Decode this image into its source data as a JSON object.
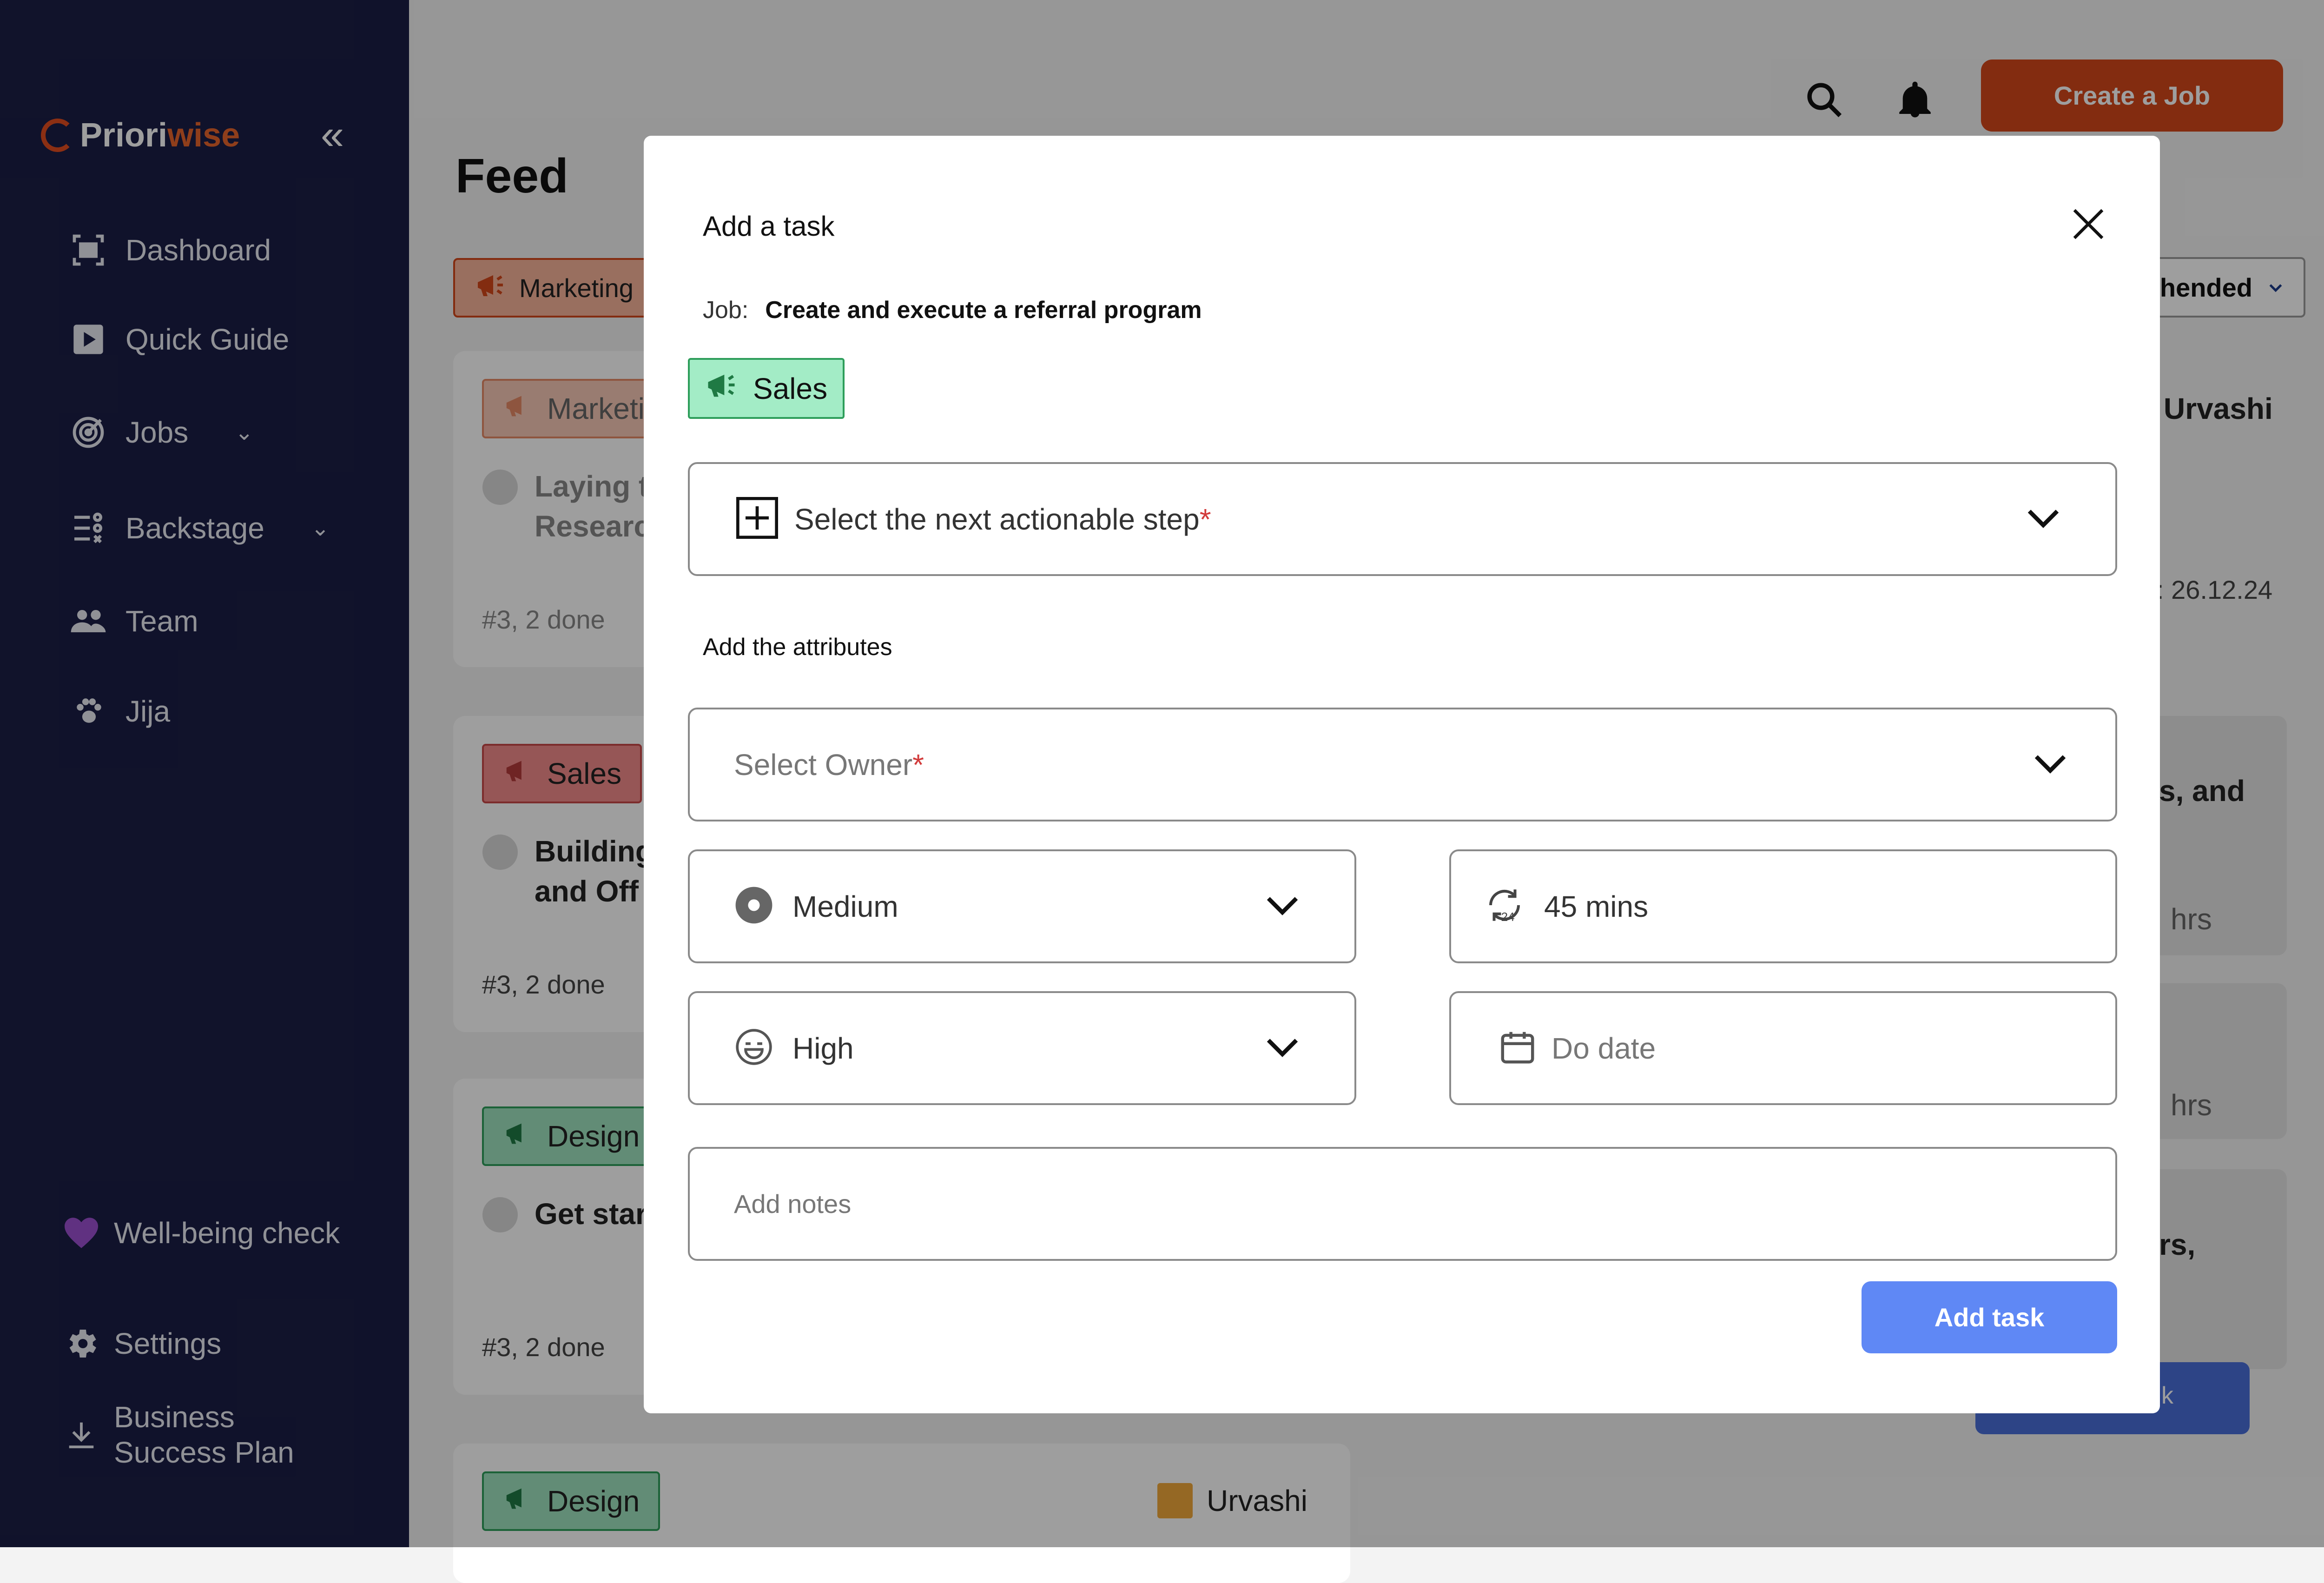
{
  "app": {
    "logo_main": "Priori",
    "logo_accent": "wise",
    "collapse_icon": "double-chevron-left-icon"
  },
  "sidebar": {
    "items": [
      {
        "label": "Dashboard",
        "icon": "dashboard-icon"
      },
      {
        "label": "Quick Guide",
        "icon": "play-icon"
      },
      {
        "label": "Jobs",
        "icon": "target-icon"
      },
      {
        "label": "Backstage",
        "icon": "list-icon"
      },
      {
        "label": "Team",
        "icon": "team-icon"
      },
      {
        "label": "Jija",
        "icon": "paw-icon"
      }
    ],
    "wellbeing": "Well-being check",
    "settings": "Settings",
    "business_line1": "Business",
    "business_line2": "Success Plan"
  },
  "header": {
    "create_job": "Create a Job",
    "feed_title": "Feed"
  },
  "filters": {
    "category": "Marketing",
    "sort": "hended"
  },
  "feed": {
    "cards": [
      {
        "tag": "Marketi",
        "title1": "Laying t",
        "title2": "Researc",
        "meta": "#3, 2 done"
      },
      {
        "tag": "Sales",
        "title1": "Building",
        "title2": "and Off",
        "meta": "#3, 2 done"
      },
      {
        "tag": "Design",
        "title1": "Get star",
        "meta": "#3, 2 done"
      },
      {
        "tag": "Design",
        "owner": "Urvashi"
      }
    ]
  },
  "right_panel": {
    "owner": "Urvashi",
    "date_text": ": 26.12.24",
    "snip1": "s, and",
    "snip2": "hrs",
    "snip3": "hrs",
    "snip4": "rs,",
    "btn_snip": "k"
  },
  "modal": {
    "title": "Add a task",
    "job_label": "Job:",
    "job_value": "Create and execute a referral program",
    "tag": "Sales",
    "next_step": "Select the next actionable step",
    "required": "*",
    "attributes_title": "Add the attributes",
    "owner_placeholder": "Select Owner",
    "priority": "Medium",
    "duration": "45 mins",
    "energy": "High",
    "do_date": "Do date",
    "notes_placeholder": "Add notes",
    "submit": "Add task"
  },
  "colors": {
    "sidebar_bg": "#1b1e46",
    "accent": "#d4471b",
    "sales_tag_bg": "#a3ecc6",
    "primary_button": "#5f88f5"
  }
}
